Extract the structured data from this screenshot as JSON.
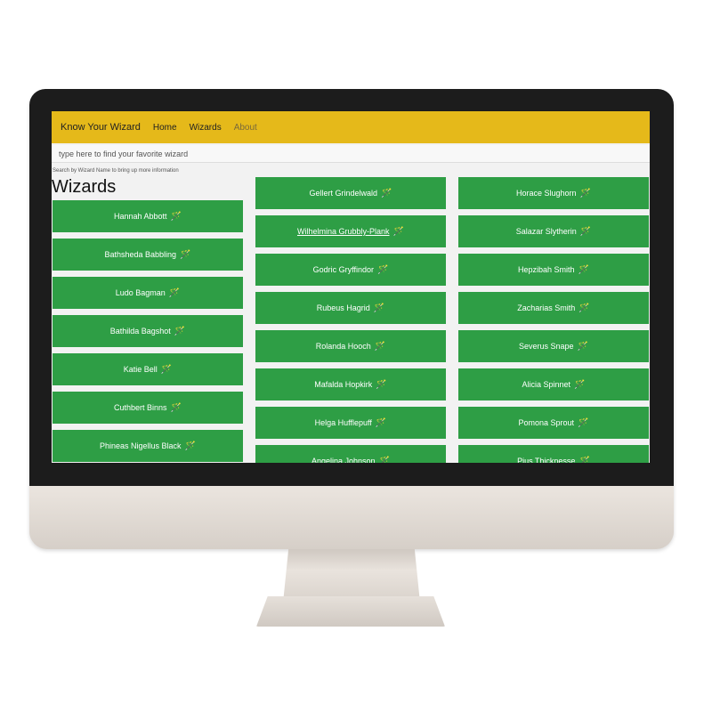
{
  "navbar": {
    "brand": "Know Your Wizard",
    "links": [
      "Home",
      "Wizards",
      "About"
    ]
  },
  "search": {
    "placeholder": "type here to find your favorite wizard",
    "hint": "Search by Wizard Name to bring up more information"
  },
  "page_title": "Wizards",
  "wand_icon": "🪄",
  "columns": [
    [
      {
        "name": "Hannah Abbott"
      },
      {
        "name": "Bathsheda Babbling"
      },
      {
        "name": "Ludo Bagman"
      },
      {
        "name": "Bathilda Bagshot"
      },
      {
        "name": "Katie Bell"
      },
      {
        "name": "Cuthbert Binns"
      },
      {
        "name": "Phineas Nigellus Black"
      }
    ],
    [
      {
        "name": "Gellert Grindelwald"
      },
      {
        "name": "Wilhelmina Grubbly-Plank",
        "underlined": true
      },
      {
        "name": "Godric Gryffindor"
      },
      {
        "name": "Rubeus Hagrid"
      },
      {
        "name": "Rolanda Hooch"
      },
      {
        "name": "Mafalda Hopkirk"
      },
      {
        "name": "Helga Hufflepuff"
      },
      {
        "name": "Angelina Johnson"
      }
    ],
    [
      {
        "name": "Horace Slughorn"
      },
      {
        "name": "Salazar Slytherin"
      },
      {
        "name": "Hepzibah Smith"
      },
      {
        "name": "Zacharias Smith"
      },
      {
        "name": "Severus Snape"
      },
      {
        "name": "Alicia Spinnet"
      },
      {
        "name": "Pomona Sprout"
      },
      {
        "name": "Pius Thicknesse"
      }
    ]
  ],
  "colors": {
    "navbar": "#e5b91a",
    "card": "#2e9e45",
    "card_text": "#ffffff",
    "bezel": "#1c1c1c"
  }
}
